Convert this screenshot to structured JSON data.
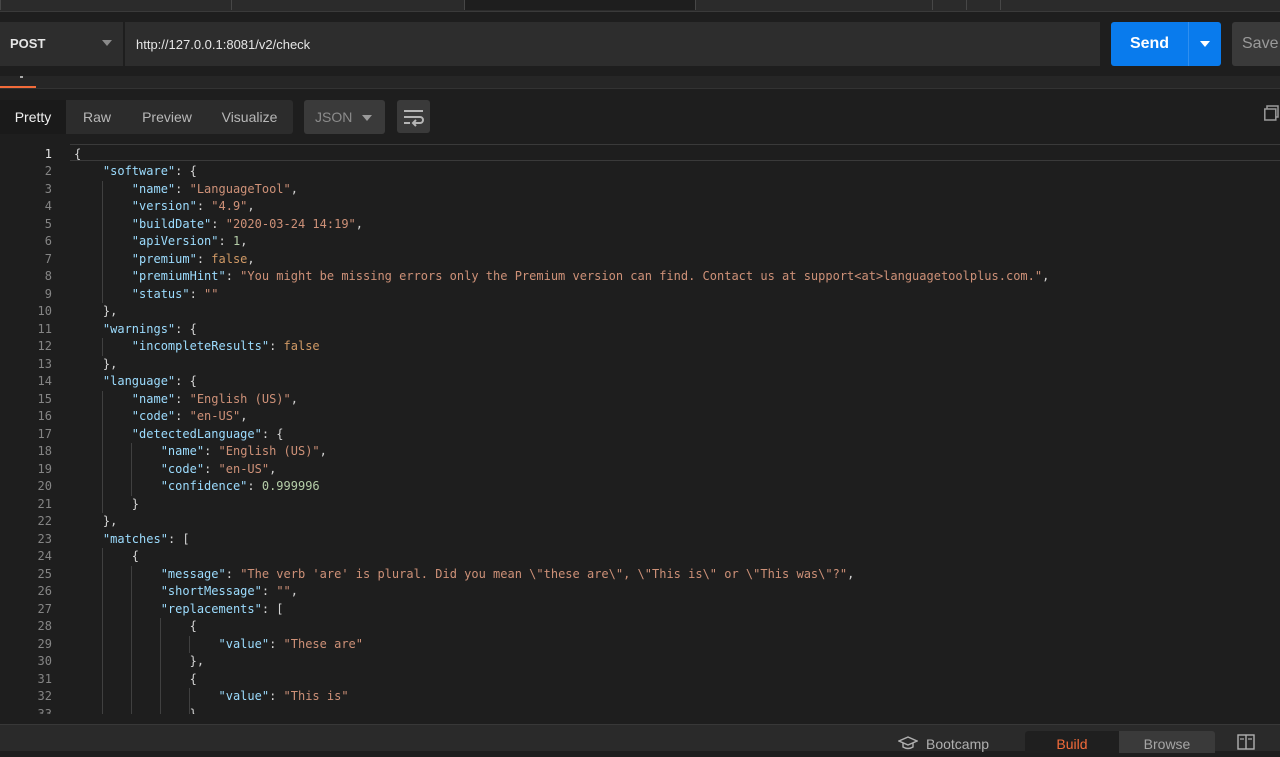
{
  "request": {
    "method": "POST",
    "url": "http://127.0.0.1:8081/v2/check",
    "send_label": "Send",
    "save_label": "Save"
  },
  "response_view": {
    "tabs": [
      "Pretty",
      "Raw",
      "Preview",
      "Visualize"
    ],
    "active_tab": "Pretty",
    "format": "JSON"
  },
  "code_lines": [
    "{",
    "    \"software\": {",
    "        \"name\": \"LanguageTool\",",
    "        \"version\": \"4.9\",",
    "        \"buildDate\": \"2020-03-24 14:19\",",
    "        \"apiVersion\": 1,",
    "        \"premium\": false,",
    "        \"premiumHint\": \"You might be missing errors only the Premium version can find. Contact us at support<at>languagetoolplus.com.\",",
    "        \"status\": \"\"",
    "    },",
    "    \"warnings\": {",
    "        \"incompleteResults\": false",
    "    },",
    "    \"language\": {",
    "        \"name\": \"English (US)\",",
    "        \"code\": \"en-US\",",
    "        \"detectedLanguage\": {",
    "            \"name\": \"English (US)\",",
    "            \"code\": \"en-US\",",
    "            \"confidence\": 0.999996",
    "        }",
    "    },",
    "    \"matches\": [",
    "        {",
    "            \"message\": \"The verb 'are' is plural. Did you mean \\\"these are\\\", \\\"This is\\\" or \\\"This was\\\"?\",",
    "            \"shortMessage\": \"\",",
    "            \"replacements\": [",
    "                {",
    "                    \"value\": \"These are\"",
    "                },",
    "                {",
    "                    \"value\": \"This is\"",
    "                },"
  ],
  "line_numbers": [
    "1",
    "2",
    "3",
    "4",
    "5",
    "6",
    "7",
    "8",
    "9",
    "10",
    "11",
    "12",
    "13",
    "14",
    "15",
    "16",
    "17",
    "18",
    "19",
    "20",
    "21",
    "22",
    "23",
    "24",
    "25",
    "26",
    "27",
    "28",
    "29",
    "30",
    "31",
    "32",
    "33"
  ],
  "statusbar": {
    "bootcamp_label": "Bootcamp",
    "build_label": "Build",
    "browse_label": "Browse"
  },
  "colors": {
    "send": "#097bed",
    "accent": "#f26b3a",
    "key": "#9cdcfe",
    "string": "#ce9178",
    "number": "#b5cea8"
  }
}
